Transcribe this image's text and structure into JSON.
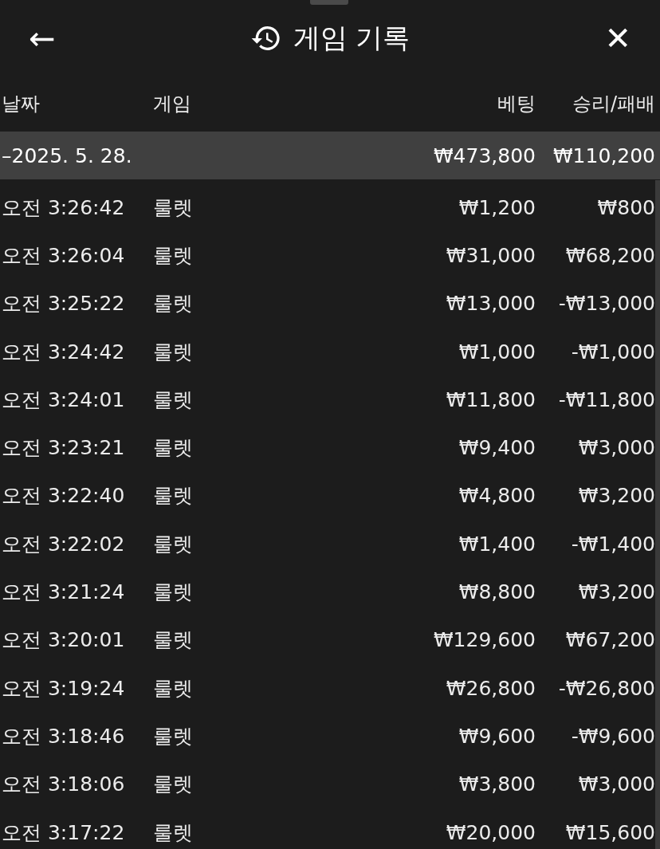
{
  "header": {
    "back": "←",
    "title": "게임 기록",
    "close": "✕"
  },
  "columns": [
    "날짜",
    "게임",
    "베팅",
    "승리/패배"
  ],
  "date_group": {
    "date": "–2025. 5. 28.",
    "bet": "₩473,800",
    "result": "₩110,200"
  },
  "rows": [
    {
      "time": "오전 3:26:42",
      "game": "룰렛",
      "bet": "₩1,200",
      "result": "₩800"
    },
    {
      "time": "오전 3:26:04",
      "game": "룰렛",
      "bet": "₩31,000",
      "result": "₩68,200"
    },
    {
      "time": "오전 3:25:22",
      "game": "룰렛",
      "bet": "₩13,000",
      "result": "-₩13,000"
    },
    {
      "time": "오전 3:24:42",
      "game": "룰렛",
      "bet": "₩1,000",
      "result": "-₩1,000"
    },
    {
      "time": "오전 3:24:01",
      "game": "룰렛",
      "bet": "₩11,800",
      "result": "-₩11,800"
    },
    {
      "time": "오전 3:23:21",
      "game": "룰렛",
      "bet": "₩9,400",
      "result": "₩3,000"
    },
    {
      "time": "오전 3:22:40",
      "game": "룰렛",
      "bet": "₩4,800",
      "result": "₩3,200"
    },
    {
      "time": "오전 3:22:02",
      "game": "룰렛",
      "bet": "₩1,400",
      "result": "-₩1,400"
    },
    {
      "time": "오전 3:21:24",
      "game": "룰렛",
      "bet": "₩8,800",
      "result": "₩3,200"
    },
    {
      "time": "오전 3:20:01",
      "game": "룰렛",
      "bet": "₩129,600",
      "result": "₩67,200"
    },
    {
      "time": "오전 3:19:24",
      "game": "룰렛",
      "bet": "₩26,800",
      "result": "-₩26,800"
    },
    {
      "time": "오전 3:18:46",
      "game": "룰렛",
      "bet": "₩9,600",
      "result": "-₩9,600"
    },
    {
      "time": "오전 3:18:06",
      "game": "룰렛",
      "bet": "₩3,800",
      "result": "₩3,000"
    },
    {
      "time": "오전 3:17:22",
      "game": "룰렛",
      "bet": "₩20,000",
      "result": "₩15,600"
    }
  ]
}
